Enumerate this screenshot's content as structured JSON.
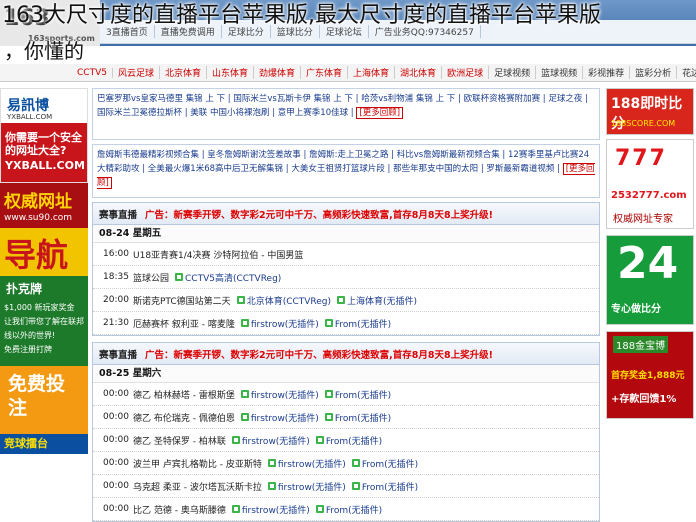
{
  "overlay": {
    "line1": "163大尺寸度的直播平台苹果版,最大尺寸度的直播平台苹果版",
    "line2": "，你懂的"
  },
  "site": {
    "logo_text": "163",
    "logo_domain": "163sports.com",
    "topnav": [
      "3直播首页",
      "直播免费调用",
      "足球比分",
      "篮球比分",
      "足球论坛",
      "",
      "广告业务QQ:97346257"
    ],
    "subnav": [
      "CCTV5",
      "风云足球",
      "北京体育",
      "山东体育",
      "劲爆体育",
      "广东体育",
      "上海体育",
      "",
      "湖北体育",
      "欧洲足球",
      "足球视频",
      "篮球视频",
      "彩视推荐",
      "篮彩分析",
      "花边新闻"
    ]
  },
  "left_ads": {
    "ad1": {
      "brand": "易訊博",
      "domain": "YXBALL.COM",
      "question": "你需要一个安全的网址大全?",
      "bottom": "YXBALL.COM"
    },
    "ad2": {
      "title": "权威网址",
      "domain": "www.su90.com"
    },
    "ad3": {
      "title": "导航"
    },
    "ad4": {
      "title": "扑克牌",
      "lines": [
        "$1,000 新玩家奖金",
        "让我们带您了解在联邦",
        "线以外的世界!",
        "免费注册打牌"
      ]
    },
    "ad5": {
      "title": "免费投注",
      "bottom": "竞球擂台"
    }
  },
  "right_ads": {
    "ad1": {
      "title": "188即时比分",
      "domain": "188SCORE.COM"
    },
    "ad2": {
      "bars": "777",
      "number": "2532777.com",
      "desc": "权威网址专家"
    },
    "ad3": {
      "title": "24",
      "desc": "专心做比分"
    },
    "ad4": {
      "logo": "188金宝博",
      "a": "首存奖金1,888元",
      "b": "+存款回馈1%"
    }
  },
  "linkbox1": {
    "items": [
      "巴塞罗那vs皇家马德里 集锦 上 下",
      "国际米兰vs瓦斯卡伊 集锦 上 下",
      "哈茨vs利物浦 集锦 上 下",
      "欧联杯资格赛附加赛",
      "足球之夜",
      "国际米兰卫冕德拉斯杯",
      "美联 中国小将裸泡刷",
      "意甲上赛季10佳球"
    ],
    "more": "[更多回顾]"
  },
  "linkbox2": {
    "items": [
      "詹姆斯韦德最精彩视频合集",
      "皇冬詹姆斯谢沈签差故事",
      "詹姆斯:走上卫冕之路",
      "科比vs詹姆斯最新视频合集",
      "12赛季里基卢比赛24大精彩助攻",
      "全美最火爆1米68高中后卫无解集锦",
      "大美女王祖贤打篮球片段",
      "那些年那支中国的太阳",
      "罗斯最新霸道视频"
    ],
    "more": "[更多回顾]"
  },
  "panels": [
    {
      "label": "赛事直播",
      "ad": "广告：新赛季开锣、数字彩2元可中千万、高频彩快速致富,首存8月8天8上奖升级!",
      "date": "08-24 星期五",
      "matches": [
        {
          "time": "16:00",
          "teams": "U18亚青赛1/4决赛 沙特阿拉伯 - 中国男篮",
          "channels": []
        },
        {
          "time": "18:35",
          "teams": "篮球公园",
          "channels": [
            "CCTV5高清(CCTVReg)"
          ]
        },
        {
          "time": "20:00",
          "teams": "斯诺克PTC德国站第二天",
          "channels": [
            "北京体育(CCTVReg)",
            "上海体育(无插件)"
          ]
        },
        {
          "time": "21:30",
          "teams": "厄赫赛杯 叙利亚 - 喀麦隆",
          "channels": [
            "firstrow(无插件)",
            "From(无插件)"
          ]
        }
      ]
    },
    {
      "label": "赛事直播",
      "ad": "广告：新赛季开锣、数字彩2元可中千万、高频彩快速致富,首存8月8天8上奖升级!",
      "date": "08-25 星期六",
      "matches": [
        {
          "time": "00:00",
          "teams": "德乙 柏林赫塔 - 雷根斯堡",
          "channels": [
            "firstrow(无插件)",
            "From(无插件)"
          ]
        },
        {
          "time": "00:00",
          "teams": "德乙 布伦瑞克 - 佩德伯恩",
          "channels": [
            "firstrow(无插件)",
            "From(无插件)"
          ]
        },
        {
          "time": "00:00",
          "teams": "德乙 圣特保罗 - 柏林联",
          "channels": [
            "firstrow(无插件)",
            "From(无插件)"
          ]
        },
        {
          "time": "00:00",
          "teams": "波兰甲 卢宾扎格勒比 - 皮亚斯特",
          "channels": [
            "firstrow(无插件)",
            "From(无插件)"
          ]
        },
        {
          "time": "00:00",
          "teams": "乌克超 柔亚 - 波尔塔瓦沃斯卡拉",
          "channels": [
            "firstrow(无插件)",
            "From(无插件)"
          ]
        },
        {
          "time": "00:00",
          "teams": "比乙 范德 - 奥乌斯滕德",
          "channels": [
            "firstrow(无插件)",
            "From(无插件)"
          ]
        }
      ]
    }
  ]
}
